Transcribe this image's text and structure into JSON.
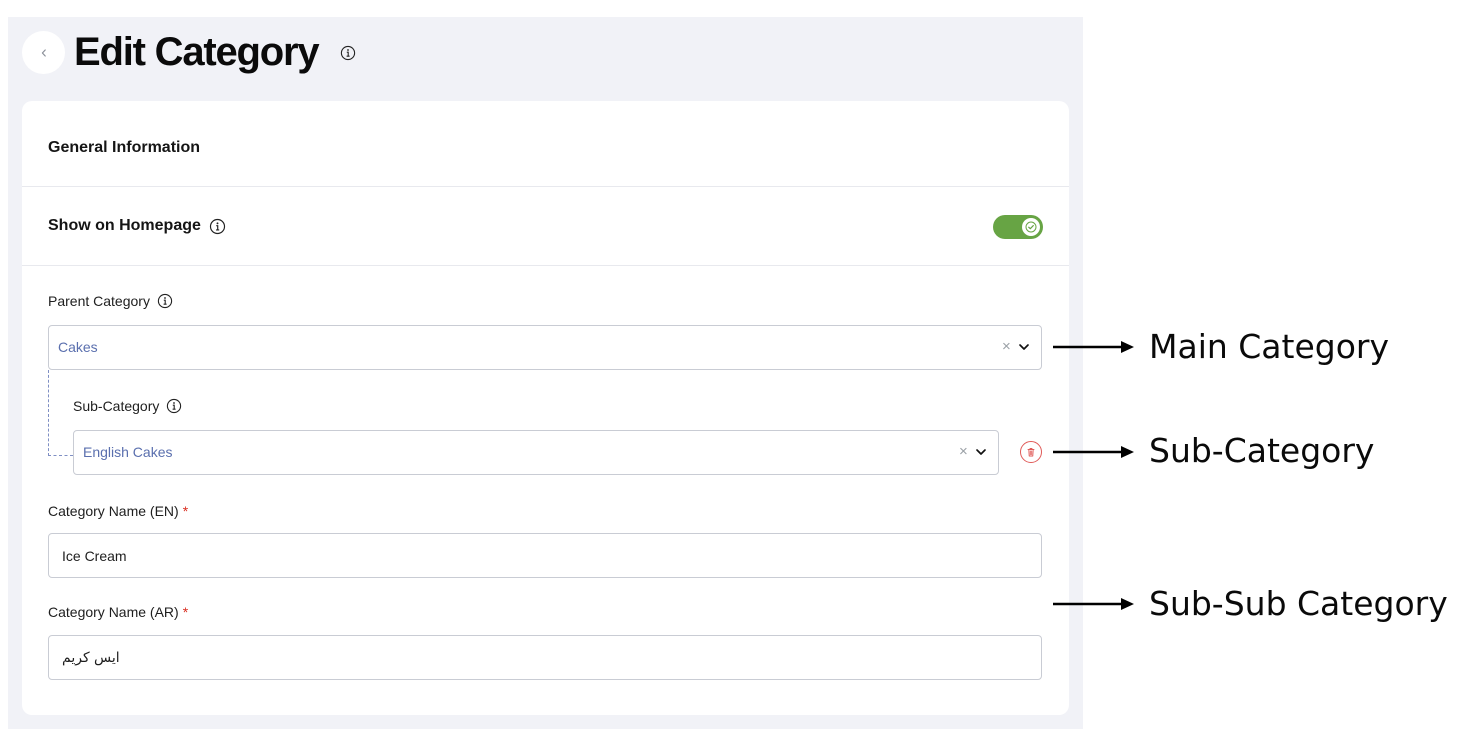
{
  "header": {
    "title": "Edit Category",
    "back_icon": "chevron-left-icon",
    "info_icon": "info-icon"
  },
  "general": {
    "section_title": "General Information",
    "show_on_homepage_label": "Show on Homepage",
    "show_on_homepage_enabled": true
  },
  "fields": {
    "parent_category_label": "Parent Category",
    "parent_category_value": "Cakes",
    "sub_category_label": "Sub-Category",
    "sub_category_value": "English Cakes",
    "name_en_label": "Category Name (EN)",
    "name_en_value": "Ice Cream",
    "name_ar_label": "Category Name (AR)",
    "name_ar_value": "ايس كريم",
    "required_mark": "*",
    "clear_symbol": "×"
  },
  "annotations": {
    "main": "Main Category",
    "sub": "Sub-Category",
    "subsub": "Sub-Sub Category"
  },
  "colors": {
    "toggle_on": "#67a444",
    "select_value": "#5a6fae",
    "required": "#d92d20",
    "delete": "#e05a58",
    "panel_bg": "#f1f2f7"
  }
}
